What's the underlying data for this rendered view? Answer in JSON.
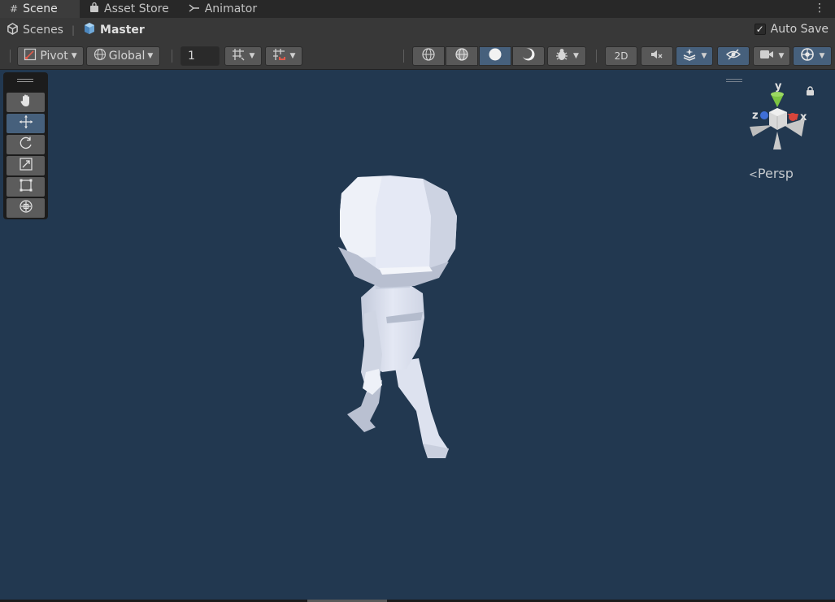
{
  "tabs": [
    {
      "label": "Scene",
      "icon": "hash-icon",
      "glyph": "#"
    },
    {
      "label": "Asset Store",
      "icon": "bag-icon",
      "glyph": "▣"
    },
    {
      "label": "Animator",
      "icon": "animator-icon",
      "glyph": "⤳"
    }
  ],
  "tab_menu": "⋮",
  "breadcrumb": {
    "scenes_label": "Scenes",
    "master_label": "Master"
  },
  "autosave": {
    "label": "Auto Save",
    "checked": "✓"
  },
  "toolbar": {
    "pivot_label": "Pivot",
    "global_label": "Global",
    "grid_value": "1",
    "mode_2d_label": "2D"
  },
  "viewport": {
    "projection_label": "Persp",
    "background_color": "#223850"
  },
  "gizmo": {
    "y_label": "y",
    "z_label": "z",
    "x_label": "x"
  },
  "colors": {
    "accent": "#46607c",
    "axis_x": "#d8453b",
    "axis_y": "#7cc442",
    "axis_z": "#3f6fd6"
  }
}
